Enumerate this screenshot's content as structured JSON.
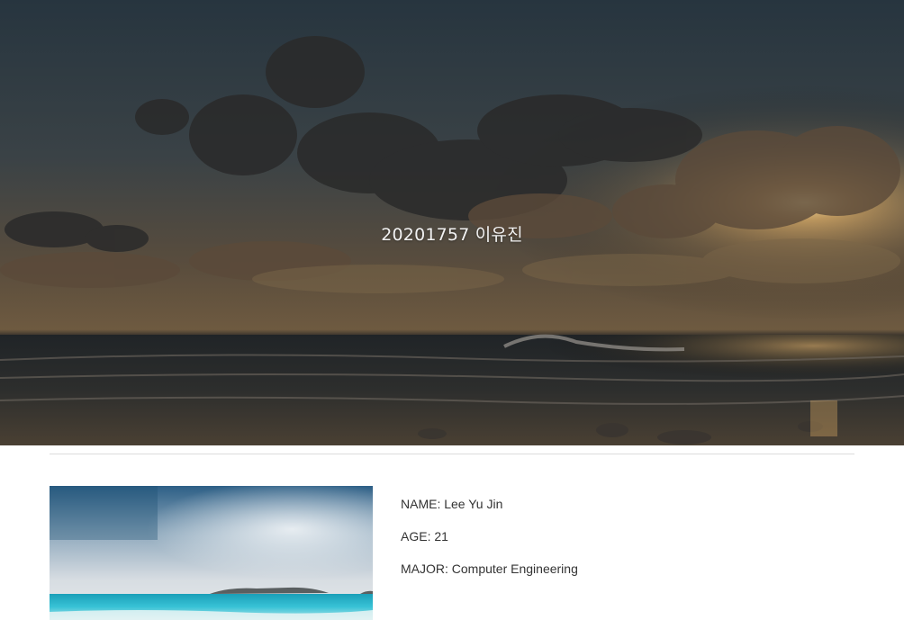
{
  "hero": {
    "title": "20201757 이유진"
  },
  "profile": {
    "name_label": "NAME:",
    "name_value": "Lee Yu Jin",
    "age_label": "AGE:",
    "age_value": "21",
    "major_label": "MAJOR:",
    "major_value": "Computer Engineering"
  },
  "colors": {
    "hero_sky_top": "#2b3944",
    "hero_sun": "#f0c27a",
    "divider": "#dcdcdc",
    "text": "#333333"
  }
}
